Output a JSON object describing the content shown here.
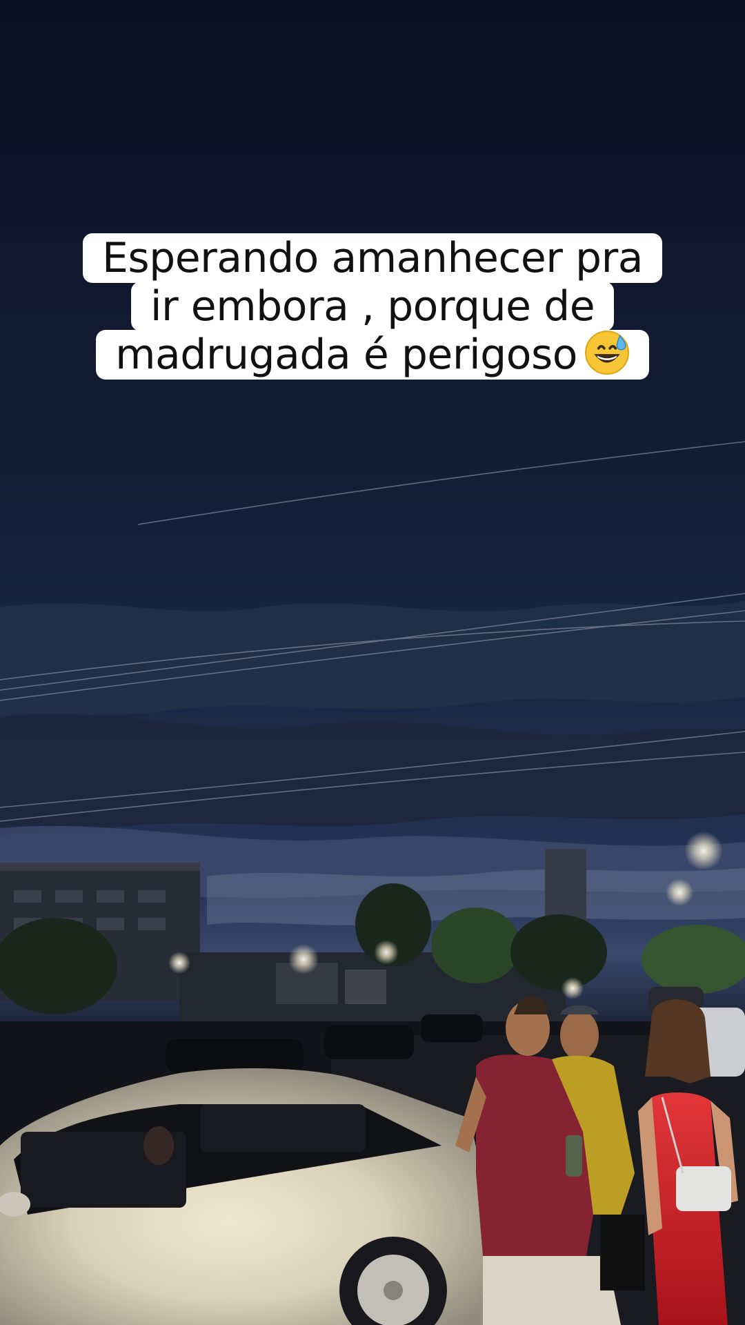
{
  "caption": {
    "lines": [
      "Esperando amanhecer pra",
      "ir embora , porque de",
      "madrugada é perigoso"
    ],
    "emoji": "grinning-face-with-sweat"
  },
  "colors": {
    "sky_top": "#0b1222",
    "sky_mid": "#1c2a47",
    "horizon": "#3a4a6c",
    "caption_bg": "#ffffff",
    "caption_text": "#111111",
    "car_white": "#e9e4d8",
    "shirt_red": "#8e2637",
    "shirt_yellow": "#c9a827",
    "dress_red": "#e2262e"
  }
}
